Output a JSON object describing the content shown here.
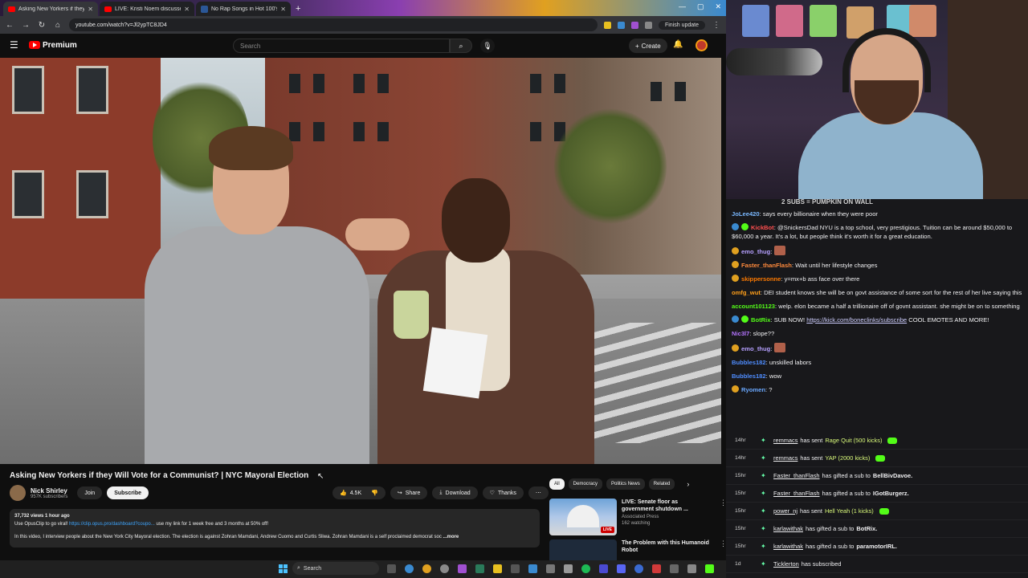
{
  "browser": {
    "tabs": [
      {
        "label": "Asking New Yorkers if they Wil",
        "kind": "youtube",
        "active": true
      },
      {
        "label": "LIVE: Kristi Noem discusses 'Op",
        "kind": "youtube",
        "active": false
      },
      {
        "label": "No Rap Songs in Hot 100's Top",
        "kind": "bing",
        "active": false
      }
    ],
    "new_tab": "+",
    "window_controls": [
      "—",
      "▢",
      "✕"
    ],
    "url": "youtube.com/watch?v=Jl2ypTC8JD4",
    "finish_update": "Finish update"
  },
  "youtube": {
    "logo": "Premium",
    "search_placeholder": "Search",
    "create_label": "Create",
    "video_title": "Asking New Yorkers if they Will Vote for a Communist? | NYC Mayoral Election",
    "channel": {
      "name": "Nick Shirley",
      "subscribers": "957K subscribers"
    },
    "join_label": "Join",
    "subscribe_label": "Subscribe",
    "actions": {
      "likes": "4.5K",
      "share": "Share",
      "download": "Download",
      "thanks": "Thanks"
    },
    "description": {
      "stats": "37,732 views  1 hour ago",
      "line1_pre": "Use OpusClip to go viral! ",
      "line1_link": "https://clip.opus.pro/dashboard?coupo...",
      "line1_post": " use my link for 1 week free and 3 months at 50% off!",
      "line2": "In this video, I interview people about the New York City Mayoral election. The election is against Zohran Mamdani, Andrew Cuomo and Curtis Sliwa. Zohran Mamdani is a self proclaimed democrat soc",
      "more": "...more"
    },
    "chips": [
      "All",
      "Democracy",
      "Politics News",
      "Related"
    ],
    "recommendations": [
      {
        "title": "LIVE: Senate floor as government shutdown ...",
        "channel": "Associated Press",
        "meta": "162 watching",
        "badge": "LIVE"
      },
      {
        "title": "The Problem with this Humanoid Robot",
        "channel": "",
        "meta": "",
        "badge": ""
      }
    ]
  },
  "chat": {
    "goal": "2 SUBS = PUMPKIN ON WALL",
    "messages": [
      {
        "user": "JoLee420",
        "color": "#7ab8ff",
        "text": "says every billionaire when they were poor",
        "badge": ""
      },
      {
        "user": "KickBot",
        "color": "#ff4f4f",
        "text": "@SnickersDad NYU is a top school, very prestigious. Tuition can be around $50,000 to $60,000 a year. It's a lot, but people think it's worth it for a great education.",
        "badge": "bot"
      },
      {
        "user": "emo_thug",
        "color": "#b6a0ff",
        "text": "",
        "badge": "sub",
        "emote": true
      },
      {
        "user": "Faster_thanFlash",
        "color": "#ff8a3c",
        "text": "Wait until her lifestyle changes",
        "badge": "sub"
      },
      {
        "user": "skippersonne",
        "color": "#ff7a00",
        "text": "y=mx+b ass face over there",
        "badge": "sub"
      },
      {
        "user": "omfg_wut",
        "color": "#ff9f1a",
        "text": "DEI student knows she will be on govt assistance of some sort for the rest of her live saying this",
        "badge": ""
      },
      {
        "user": "account101123",
        "color": "#53fc18",
        "text": "welp. elon became a half a trillionaire off of govnt assistant. she might be on to something",
        "badge": ""
      },
      {
        "user": "BotRix",
        "color": "#53fc18",
        "text": "SUB NOW! ",
        "link": "https://kick.com/boneclinks/subscribe",
        "after": " COOL EMOTES AND MORE!",
        "badge": "bot"
      },
      {
        "user": "Nic3l7",
        "color": "#b574ff",
        "text": "slope??",
        "badge": ""
      },
      {
        "user": "emo_thug",
        "color": "#b6a0ff",
        "text": "",
        "badge": "sub",
        "emote": true
      },
      {
        "user": "Bubbles182",
        "color": "#4f8dff",
        "text": "unskilled labors",
        "badge": ""
      },
      {
        "user": "Bubbles182",
        "color": "#4f8dff",
        "text": "wow",
        "badge": ""
      },
      {
        "user": "Ryomen",
        "color": "#6aa8ff",
        "text": "?",
        "badge": "sub"
      }
    ]
  },
  "events": [
    {
      "time": "14hr",
      "user": "remmacs",
      "pre": "has sent",
      "highlight": "Rage Quit (500 kicks)",
      "post": "",
      "kick": true
    },
    {
      "time": "14hr",
      "user": "remmacs",
      "pre": "has sent",
      "highlight": "YAP (2000 kicks)",
      "post": "",
      "kick": true
    },
    {
      "time": "15hr",
      "user": "Faster_thanFlash",
      "pre": "has gifted a sub to",
      "highlight": "",
      "post": "BellBivDavoe.",
      "kick": false
    },
    {
      "time": "15hr",
      "user": "Faster_thanFlash",
      "pre": "has gifted a sub to",
      "highlight": "",
      "post": "IGotBurgerz.",
      "kick": false
    },
    {
      "time": "15hr",
      "user": "power_nj",
      "pre": "has sent",
      "highlight": "Hell Yeah (1 kicks)",
      "post": "",
      "kick": true
    },
    {
      "time": "15hr",
      "user": "karlawithak",
      "pre": "has gifted a sub to",
      "highlight": "",
      "post": "BotRix.",
      "kick": false
    },
    {
      "time": "15hr",
      "user": "karlawithak",
      "pre": "has gifted a sub to",
      "highlight": "",
      "post": "paramotorIRL.",
      "kick": false
    },
    {
      "time": "1d",
      "user": "Ticklerton",
      "pre": "has subscribed",
      "highlight": "",
      "post": "",
      "kick": false
    }
  ],
  "taskbar": {
    "search_placeholder": "Search"
  }
}
